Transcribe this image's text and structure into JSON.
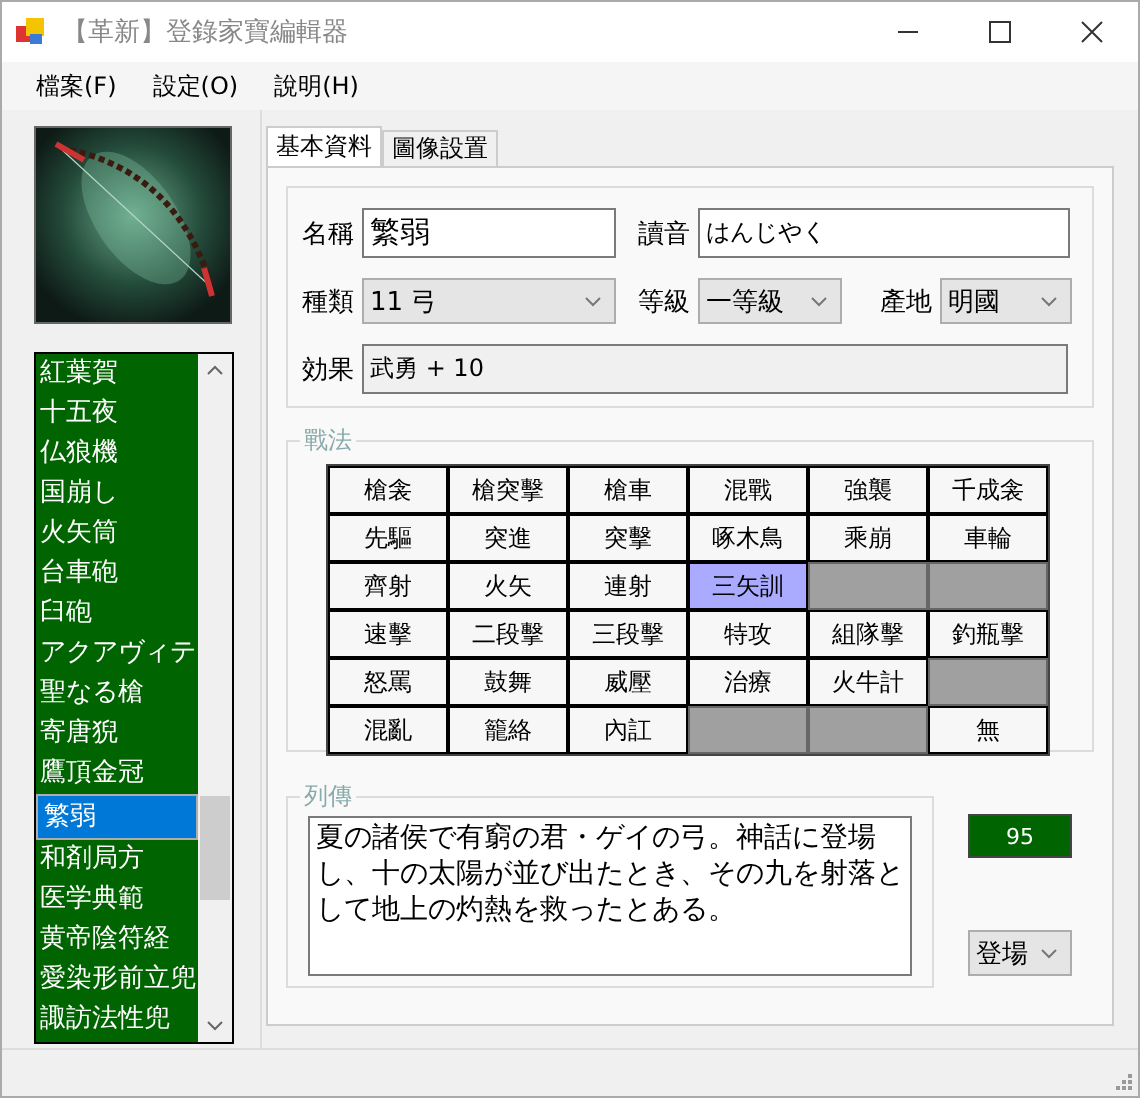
{
  "window": {
    "title": "【革新】登錄家寶編輯器"
  },
  "menu": [
    "檔案(F)",
    "設定(O)",
    "說明(H)"
  ],
  "items": [
    {
      "label": "紅葉賀",
      "selected": false
    },
    {
      "label": "十五夜",
      "selected": false
    },
    {
      "label": "仏狼機",
      "selected": false
    },
    {
      "label": "国崩し",
      "selected": false
    },
    {
      "label": "火矢筒",
      "selected": false
    },
    {
      "label": "台車砲",
      "selected": false
    },
    {
      "label": "臼砲",
      "selected": false
    },
    {
      "label": "アクアヴィテ",
      "selected": false
    },
    {
      "label": "聖なる槍",
      "selected": false
    },
    {
      "label": "寄唐猊",
      "selected": false
    },
    {
      "label": "鷹頂金冠",
      "selected": false
    },
    {
      "label": "繁弱",
      "selected": true
    },
    {
      "label": "和剤局方",
      "selected": false
    },
    {
      "label": "医学典範",
      "selected": false
    },
    {
      "label": "黄帝陰符経",
      "selected": false
    },
    {
      "label": "愛染形前立兜",
      "selected": false
    },
    {
      "label": "諏訪法性兜",
      "selected": false
    }
  ],
  "tabs": [
    {
      "label": "基本資料",
      "selected": true
    },
    {
      "label": "圖像設置",
      "selected": false
    }
  ],
  "fields": {
    "name_label": "名稱",
    "name": "繁弱",
    "reading_label": "讀音",
    "reading": "はんじやく",
    "type_label": "種類",
    "type": "11 弓",
    "grade_label": "等級",
    "grade": "一等級",
    "origin_label": "產地",
    "origin": "明國",
    "effect_label": "効果",
    "effect": "武勇 + 10"
  },
  "tactics": {
    "title": "戰法",
    "cells": [
      {
        "kind": "tactic",
        "label": "槍衾",
        "selected": false
      },
      {
        "kind": "tactic",
        "label": "槍突擊",
        "selected": false
      },
      {
        "kind": "tactic",
        "label": "槍車",
        "selected": false
      },
      {
        "kind": "tactic",
        "label": "混戰",
        "selected": false
      },
      {
        "kind": "tactic",
        "label": "強襲",
        "selected": false
      },
      {
        "kind": "tactic",
        "label": "千成衾",
        "selected": false
      },
      {
        "kind": "tactic",
        "label": "先驅",
        "selected": false
      },
      {
        "kind": "tactic",
        "label": "突進",
        "selected": false
      },
      {
        "kind": "tactic",
        "label": "突擊",
        "selected": false
      },
      {
        "kind": "tactic",
        "label": "啄木鳥",
        "selected": false
      },
      {
        "kind": "tactic",
        "label": "乘崩",
        "selected": false
      },
      {
        "kind": "tactic",
        "label": "車輪",
        "selected": false
      },
      {
        "kind": "tactic",
        "label": "齊射",
        "selected": false
      },
      {
        "kind": "tactic",
        "label": "火矢",
        "selected": false
      },
      {
        "kind": "tactic",
        "label": "連射",
        "selected": false
      },
      {
        "kind": "tactic",
        "label": "三矢訓",
        "selected": true
      },
      {
        "kind": "empty",
        "selected": false
      },
      {
        "kind": "empty",
        "selected": false
      },
      {
        "kind": "tactic",
        "label": "速擊",
        "selected": false
      },
      {
        "kind": "tactic",
        "label": "二段擊",
        "selected": false
      },
      {
        "kind": "tactic",
        "label": "三段擊",
        "selected": false
      },
      {
        "kind": "tactic",
        "label": "特攻",
        "selected": false
      },
      {
        "kind": "tactic",
        "label": "組隊擊",
        "selected": false
      },
      {
        "kind": "tactic",
        "label": "釣瓶擊",
        "selected": false
      },
      {
        "kind": "tactic",
        "label": "怒罵",
        "selected": false
      },
      {
        "kind": "tactic",
        "label": "鼓舞",
        "selected": false
      },
      {
        "kind": "tactic",
        "label": "威壓",
        "selected": false
      },
      {
        "kind": "tactic",
        "label": "治療",
        "selected": false
      },
      {
        "kind": "tactic",
        "label": "火牛計",
        "selected": false
      },
      {
        "kind": "empty",
        "selected": false
      },
      {
        "kind": "tactic",
        "label": "混亂",
        "selected": false
      },
      {
        "kind": "tactic",
        "label": "籠絡",
        "selected": false
      },
      {
        "kind": "tactic",
        "label": "內訌",
        "selected": false
      },
      {
        "kind": "empty",
        "selected": false
      },
      {
        "kind": "empty",
        "selected": false
      },
      {
        "kind": "tactic",
        "label": "無",
        "selected": false
      }
    ]
  },
  "biography": {
    "title": "列傳",
    "text": "夏の諸侯で有窮の君・ゲイの弓。神話に登場し、十の太陽が並び出たとき、その九を射落として地上の灼熱を救ったとある。"
  },
  "value": "95",
  "appearance": "登場"
}
